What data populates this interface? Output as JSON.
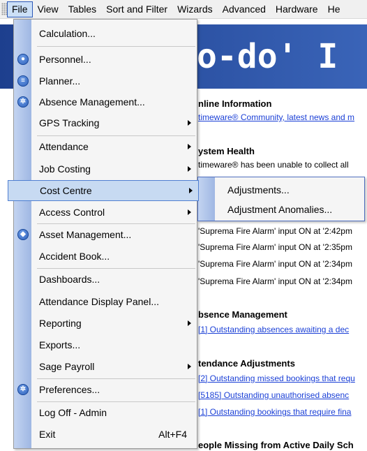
{
  "menubar": {
    "items": [
      "File",
      "View",
      "Tables",
      "Sort and Filter",
      "Wizards",
      "Advanced",
      "Hardware",
      "He"
    ],
    "active": "File"
  },
  "background": {
    "banner_text": "o-do' I",
    "sections": [
      {
        "title": "nline Information",
        "lines": [
          {
            "text": "timeware® Community, latest news and m",
            "link": true
          }
        ]
      },
      {
        "title": "ystem Health",
        "lines": [
          {
            "text": "timeware® has been unable to collect all",
            "link": false
          }
        ]
      },
      {
        "title": "",
        "lines": [
          {
            "text": "'Suprema Fire Alarm' input ON at '2:42pm",
            "link": false
          },
          {
            "text": "'Suprema Fire Alarm' input ON at '2:35pm",
            "link": false
          },
          {
            "text": "'Suprema Fire Alarm' input ON at '2:34pm",
            "link": false
          },
          {
            "text": "'Suprema Fire Alarm' input ON at '2:34pm",
            "link": false
          }
        ]
      },
      {
        "title": "bsence Management",
        "lines": [
          {
            "text": "[1] Outstanding absences awaiting a dec",
            "link": true
          }
        ]
      },
      {
        "title": "tendance Adjustments",
        "lines": [
          {
            "text": "[2] Outstanding missed bookings that requ",
            "link": true
          },
          {
            "text": "[5185] Outstanding unauthorised absenc",
            "link": true
          },
          {
            "text": "[1] Outstanding bookings that require fina",
            "link": true
          }
        ]
      },
      {
        "title": "eople Missing from Active Daily Sch",
        "lines": []
      }
    ]
  },
  "file_menu": {
    "items": [
      {
        "label": "Calculation...",
        "icon": ""
      },
      {
        "label": "Personnel...",
        "icon": "person-icon"
      },
      {
        "label": "Planner...",
        "icon": "planner-icon"
      },
      {
        "label": "Absence Management...",
        "icon": "gear-icon"
      },
      {
        "label": "GPS Tracking",
        "icon": "",
        "submenu": true
      },
      {
        "label": "Attendance",
        "icon": "",
        "submenu": true
      },
      {
        "label": "Job Costing",
        "icon": "",
        "submenu": true
      },
      {
        "label": "Cost Centre",
        "icon": "",
        "submenu": true,
        "selected": true
      },
      {
        "label": "Access Control",
        "icon": "",
        "submenu": true
      },
      {
        "label": "Asset Management...",
        "icon": "tag-icon"
      },
      {
        "label": "Accident Book...",
        "icon": ""
      },
      {
        "label": "Dashboards...",
        "icon": ""
      },
      {
        "label": "Attendance Display Panel...",
        "icon": ""
      },
      {
        "label": "Reporting",
        "icon": "",
        "submenu": true
      },
      {
        "label": "Exports...",
        "icon": ""
      },
      {
        "label": "Sage Payroll",
        "icon": "",
        "submenu": true
      },
      {
        "label": "Preferences...",
        "icon": "settings-icon"
      },
      {
        "label": "Log Off - Admin",
        "icon": ""
      },
      {
        "label": "Exit",
        "icon": "",
        "shortcut": "Alt+F4"
      }
    ]
  },
  "cost_centre_submenu": {
    "items": [
      "Adjustments...",
      "Adjustment Anomalies..."
    ]
  }
}
